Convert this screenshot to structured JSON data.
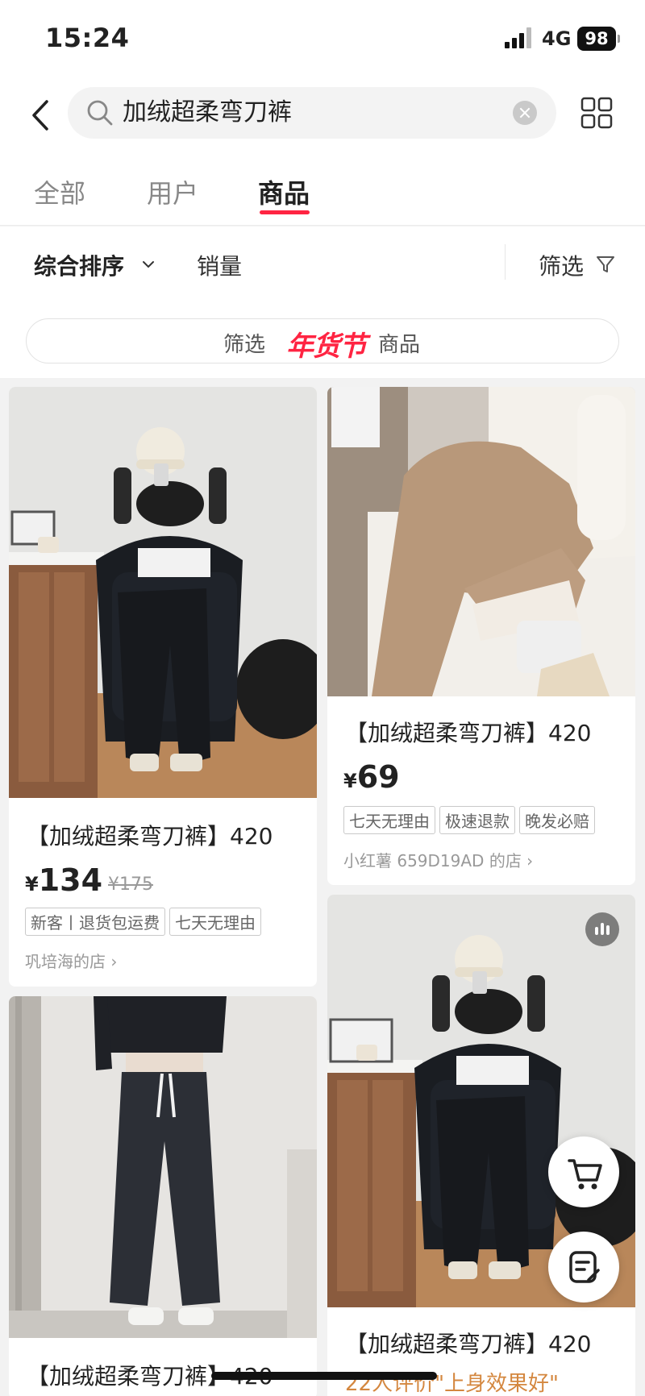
{
  "status": {
    "time": "15:24",
    "network": "4G",
    "battery": "98"
  },
  "search": {
    "query": "加绒超柔弯刀裤"
  },
  "tabs": [
    {
      "label": "全部"
    },
    {
      "label": "用户"
    },
    {
      "label": "商品"
    }
  ],
  "active_tab": "商品",
  "sort": {
    "comprehensive": "综合排序",
    "sales": "销量",
    "filter": "筛选"
  },
  "banner": {
    "prefix": "筛选",
    "festival": "年货节",
    "suffix": "商品"
  },
  "products": [
    {
      "title": "【加绒超柔弯刀裤】420",
      "currency": "¥",
      "price": "134",
      "original_price": "¥175",
      "tags": [
        "新客丨退货包运费",
        "七天无理由"
      ],
      "shop": "巩培海的店"
    },
    {
      "title": "【加绒超柔弯刀裤】420",
      "currency": "¥",
      "price": "69",
      "tags": [
        "七天无理由",
        "极速退款",
        "晚发必赔"
      ],
      "shop": "小红薯 659D19AD 的店"
    },
    {
      "title": "【加绒超柔弯刀裤】420"
    },
    {
      "title": "【加绒超柔弯刀裤】420",
      "review": "22人评价\"上身效果好\""
    }
  ],
  "colors": {
    "accent": "#ff2442",
    "review": "#d4873f"
  }
}
